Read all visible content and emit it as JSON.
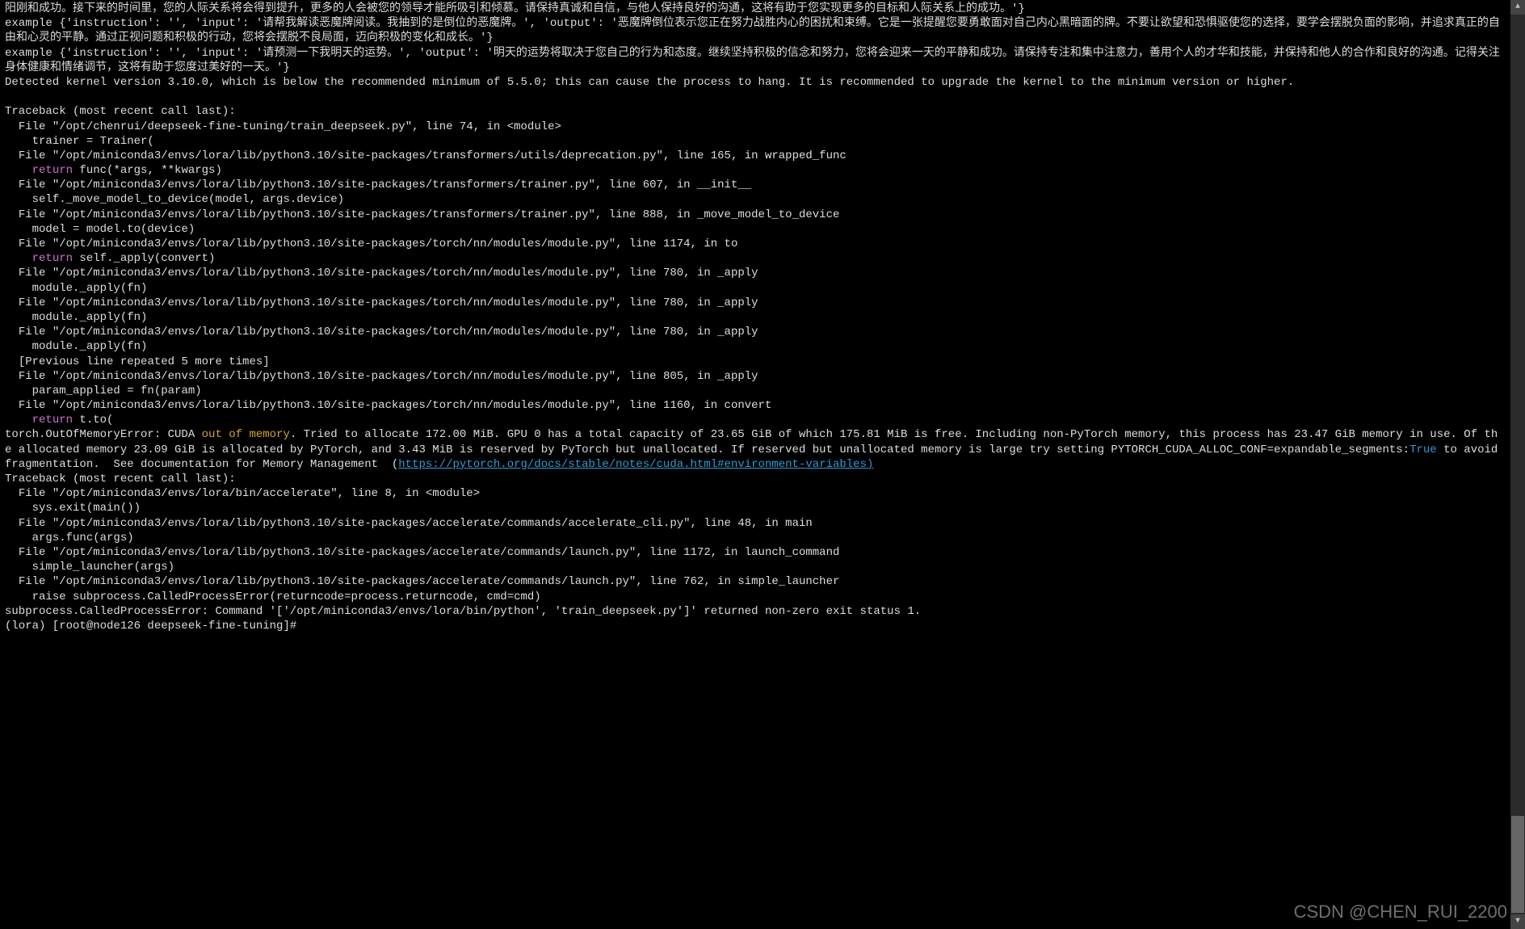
{
  "log": {
    "intro_cn_1": "阳刚和成功。接下来的时间里，您的人际关系将会得到提升，更多的人会被您的领导才能所吸引和倾慕。请保持真诚和自信，与他人保持良好的沟通，这将有助于您实现更多的目标和人际关系上的成功。'}",
    "example1_prefix": "example {'instruction': '', 'input': '请帮我解读恶魔牌阅读。我抽到的是倒位的恶魔牌。', 'output': '恶魔牌倒位表示您正在努力战胜内心的困扰和束缚。它是一张提醒您要勇敢面对自己内心黑暗面的牌。不要让欲望和恐惧驱使您的选择，要学会摆脱负面的影响，并追求真正的自由和心灵的平静。通过正视问题和积极的行动，您将会摆脱不良局面，迈向积极的变化和成长。'}",
    "example2_prefix": "example {'instruction': '', 'input': '请预测一下我明天的运势。', 'output': '明天的运势将取决于您自己的行为和态度。继续坚持积极的信念和努力，您将会迎来一天的平静和成功。请保持专注和集中注意力，善用个人的才华和技能，并保持和他人的合作和良好的沟通。记得关注身体健康和情绪调节，这将有助于您度过美好的一天。'}",
    "kernel_warning": "Detected kernel version 3.10.0, which is below the recommended minimum of 5.5.0; this can cause the process to hang. It is recommended to upgrade the kernel to the minimum version or higher.",
    "blank": "",
    "tb1_header": "Traceback (most recent call last):",
    "tb1_l1": "  File \"/opt/chenrui/deepseek-fine-tuning/train_deepseek.py\", line 74, in <module>",
    "tb1_l2": "    trainer = Trainer(",
    "tb1_l3": "  File \"/opt/miniconda3/envs/lora/lib/python3.10/site-packages/transformers/utils/deprecation.py\", line 165, in wrapped_func",
    "tb1_l4a": "    ",
    "tb1_l4_kw": "return",
    "tb1_l4b": " func(*args, **kwargs)",
    "tb1_l5": "  File \"/opt/miniconda3/envs/lora/lib/python3.10/site-packages/transformers/trainer.py\", line 607, in __init__",
    "tb1_l6": "    self._move_model_to_device(model, args.device)",
    "tb1_l7": "  File \"/opt/miniconda3/envs/lora/lib/python3.10/site-packages/transformers/trainer.py\", line 888, in _move_model_to_device",
    "tb1_l8": "    model = model.to(device)",
    "tb1_l9": "  File \"/opt/miniconda3/envs/lora/lib/python3.10/site-packages/torch/nn/modules/module.py\", line 1174, in to",
    "tb1_l10a": "    ",
    "tb1_l10_kw": "return",
    "tb1_l10b": " self._apply(convert)",
    "tb1_l11": "  File \"/opt/miniconda3/envs/lora/lib/python3.10/site-packages/torch/nn/modules/module.py\", line 780, in _apply",
    "tb1_l12": "    module._apply(fn)",
    "tb1_l13": "  File \"/opt/miniconda3/envs/lora/lib/python3.10/site-packages/torch/nn/modules/module.py\", line 780, in _apply",
    "tb1_l14": "    module._apply(fn)",
    "tb1_l15": "  File \"/opt/miniconda3/envs/lora/lib/python3.10/site-packages/torch/nn/modules/module.py\", line 780, in _apply",
    "tb1_l16": "    module._apply(fn)",
    "tb1_l17": "  [Previous line repeated 5 more times]",
    "tb1_l18": "  File \"/opt/miniconda3/envs/lora/lib/python3.10/site-packages/torch/nn/modules/module.py\", line 805, in _apply",
    "tb1_l19": "    param_applied = fn(param)",
    "tb1_l20": "  File \"/opt/miniconda3/envs/lora/lib/python3.10/site-packages/torch/nn/modules/module.py\", line 1160, in convert",
    "tb1_l21a": "    ",
    "tb1_l21_kw": "return",
    "tb1_l21b": " t.to(",
    "oom_a": "torch.OutOfMemoryError: CUDA ",
    "oom_warn": "out of memory",
    "oom_b": ". Tried to allocate 172.00 MiB. GPU 0 has a total capacity of 23.65 GiB of which 175.81 MiB is free. Including non-PyTorch memory, this process has 23.47 GiB memory in use. Of the allocated memory 23.09 GiB is allocated by PyTorch, and 3.43 MiB is reserved by PyTorch but unallocated. If reserved but unallocated memory is large try setting PYTORCH_CUDA_ALLOC_CONF=expandable_segments:",
    "oom_true": "True",
    "oom_c": " to avoid fragmentation.  See documentation for Memory Management  (",
    "oom_link": "https://pytorch.org/docs/stable/notes/cuda.html#environment-variables)",
    "tb2_header": "Traceback (most recent call last):",
    "tb2_l1": "  File \"/opt/miniconda3/envs/lora/bin/accelerate\", line 8, in <module>",
    "tb2_l2": "    sys.exit(main())",
    "tb2_l3": "  File \"/opt/miniconda3/envs/lora/lib/python3.10/site-packages/accelerate/commands/accelerate_cli.py\", line 48, in main",
    "tb2_l4": "    args.func(args)",
    "tb2_l5": "  File \"/opt/miniconda3/envs/lora/lib/python3.10/site-packages/accelerate/commands/launch.py\", line 1172, in launch_command",
    "tb2_l6": "    simple_launcher(args)",
    "tb2_l7": "  File \"/opt/miniconda3/envs/lora/lib/python3.10/site-packages/accelerate/commands/launch.py\", line 762, in simple_launcher",
    "tb2_l8": "    raise subprocess.CalledProcessError(returncode=process.returncode, cmd=cmd)",
    "sub_err": "subprocess.CalledProcessError: Command '['/opt/miniconda3/envs/lora/bin/python', 'train_deepseek.py']' returned non-zero exit status 1.",
    "prompt": "(lora) [root@node126 deepseek-fine-tuning]# "
  },
  "watermark": "CSDN @CHEN_RUI_2200",
  "scrollbar": {
    "up": "▲",
    "down": "▼"
  }
}
